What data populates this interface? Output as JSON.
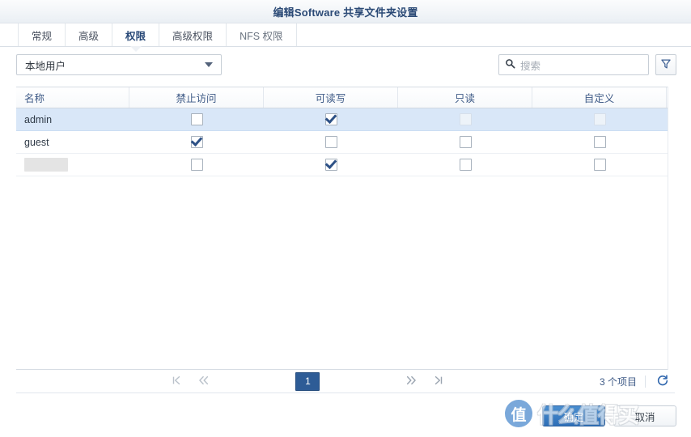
{
  "window": {
    "title": "编辑Software 共享文件夹设置"
  },
  "tabs": [
    {
      "label": "常规",
      "active": false
    },
    {
      "label": "高级",
      "active": false
    },
    {
      "label": "权限",
      "active": true
    },
    {
      "label": "高级权限",
      "active": false
    },
    {
      "label": "NFS 权限",
      "active": false
    }
  ],
  "toolbar": {
    "account_type": "本地用户",
    "search_placeholder": "搜索",
    "search_value": "",
    "search_icon": "search-icon",
    "filter_icon": "funnel-icon",
    "dropdown_icon": "chevron-down-icon"
  },
  "grid": {
    "columns": [
      {
        "key": "name",
        "label": "名称"
      },
      {
        "key": "no_access",
        "label": "禁止访问"
      },
      {
        "key": "readwrite",
        "label": "可读写"
      },
      {
        "key": "readonly",
        "label": "只读"
      },
      {
        "key": "custom",
        "label": "自定义"
      }
    ],
    "rows": [
      {
        "name": "admin",
        "redacted": false,
        "selected": true,
        "no_access": {
          "checked": false,
          "disabled": false
        },
        "readwrite": {
          "checked": true,
          "disabled": false
        },
        "readonly": {
          "checked": false,
          "disabled": true
        },
        "custom": {
          "checked": false,
          "disabled": true
        }
      },
      {
        "name": "guest",
        "redacted": false,
        "selected": false,
        "no_access": {
          "checked": true,
          "disabled": false
        },
        "readwrite": {
          "checked": false,
          "disabled": false
        },
        "readonly": {
          "checked": false,
          "disabled": false
        },
        "custom": {
          "checked": false,
          "disabled": false
        }
      },
      {
        "name": "",
        "redacted": true,
        "selected": false,
        "no_access": {
          "checked": false,
          "disabled": false
        },
        "readwrite": {
          "checked": true,
          "disabled": false
        },
        "readonly": {
          "checked": false,
          "disabled": false
        },
        "custom": {
          "checked": false,
          "disabled": false
        }
      }
    ]
  },
  "pager": {
    "first_icon": "first-page-icon",
    "prev_icon": "prev-page-icon",
    "next_icon": "next-page-icon",
    "last_icon": "last-page-icon",
    "current_page": "1",
    "item_count_label": "3 个项目",
    "refresh_icon": "refresh-icon"
  },
  "footer": {
    "ok_label": "确定",
    "cancel_label": "取消"
  },
  "watermark": {
    "badge": "值",
    "text": "什么值得买"
  },
  "colors": {
    "title_text": "#2b4a76",
    "tab_active": "#2a4a78",
    "row_selected_bg": "#d9e7f8",
    "page_active_bg": "#2e5c96",
    "primary_button": "#2f6fb8",
    "check_mark": "#2d5186",
    "header_text": "#3f5b87"
  }
}
